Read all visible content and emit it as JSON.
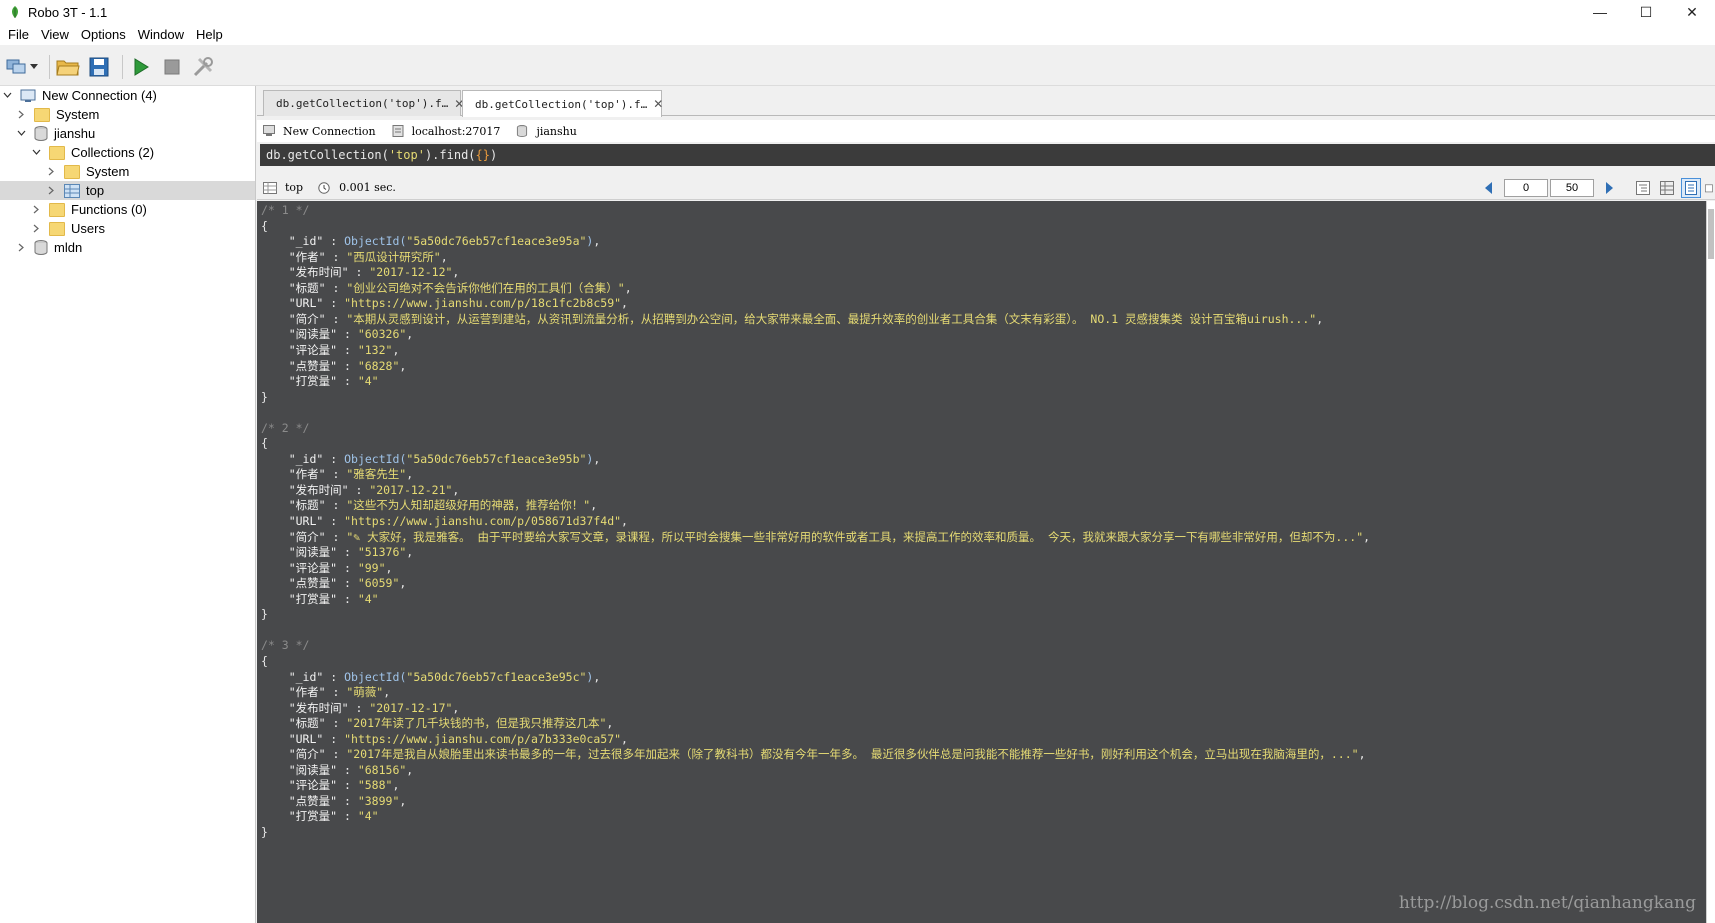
{
  "window": {
    "title": "Robo 3T - 1.1",
    "minimize_glyph": "—",
    "maximize_glyph": "☐",
    "close_glyph": "✕"
  },
  "menu": [
    "File",
    "View",
    "Options",
    "Window",
    "Help"
  ],
  "toolbar": {
    "icons": [
      "connect-icon",
      "dropdown-arrow-icon",
      "open-folder-icon",
      "save-icon",
      "run-icon",
      "stop-icon",
      "tools-icon"
    ]
  },
  "tree": {
    "connection": "New Connection (4)",
    "system_db": "System",
    "db_jianshu": "jianshu",
    "collections": "Collections (2)",
    "collections_system": "System",
    "collection_top": "top",
    "functions": "Functions (0)",
    "users": "Users",
    "db_mldn": "mldn"
  },
  "tabs": [
    {
      "label": "db.getCollection('top').f…",
      "active": false
    },
    {
      "label": "db.getCollection('top').f…",
      "active": true
    }
  ],
  "tab_close_glyph": "✕",
  "info": {
    "connection": "New Connection",
    "host": "localhost:27017",
    "database": "jianshu"
  },
  "query": {
    "prefix": "db.getCollection(",
    "collection": "'top'",
    "middle": ").find(",
    "arg": "{}",
    "suffix": ")"
  },
  "results": {
    "collection": "top",
    "time": "0.001 sec.",
    "skip": "0",
    "limit": "50"
  },
  "documents": [
    {
      "comment": "/* 1 */",
      "id": "5a50dc76eb57cf1eace3e95a",
      "fields": [
        {
          "key": "\"作者\"",
          "value": "\"西瓜设计研究所\""
        },
        {
          "key": "\"发布时间\"",
          "value": "\"2017-12-12\""
        },
        {
          "key": "\"标题\"",
          "value": "\"创业公司绝对不会告诉你他们在用的工具们（合集）\""
        },
        {
          "key": "\"URL\"",
          "value": "\"https://www.jianshu.com/p/18c1fc2b8c59\""
        },
        {
          "key": "\"简介\"",
          "value": "\"本期从灵感到设计，从运营到建站，从资讯到流量分析，从招聘到办公空间，给大家带来最全面、最提升效率的创业者工具合集（文末有彩蛋）。 NO.1 灵感搜集类 设计百宝箱uirush...\""
        },
        {
          "key": "\"阅读量\"",
          "value": "\"60326\""
        },
        {
          "key": "\"评论量\"",
          "value": "\"132\""
        },
        {
          "key": "\"点赞量\"",
          "value": "\"6828\""
        },
        {
          "key": "\"打赏量\"",
          "value": "\"4\""
        }
      ]
    },
    {
      "comment": "/* 2 */",
      "id": "5a50dc76eb57cf1eace3e95b",
      "fields": [
        {
          "key": "\"作者\"",
          "value": "\"雅客先生\""
        },
        {
          "key": "\"发布时间\"",
          "value": "\"2017-12-21\""
        },
        {
          "key": "\"标题\"",
          "value": "\"这些不为人知却超级好用的神器，推荐给你！\""
        },
        {
          "key": "\"URL\"",
          "value": "\"https://www.jianshu.com/p/058671d37f4d\""
        },
        {
          "key": "\"简介\"",
          "value": "\"✎ 大家好，我是雅客。 由于平时要给大家写文章，录课程，所以平时会搜集一些非常好用的软件或者工具，来提高工作的效率和质量。 今天，我就来跟大家分享一下有哪些非常好用，但却不为...\""
        },
        {
          "key": "\"阅读量\"",
          "value": "\"51376\""
        },
        {
          "key": "\"评论量\"",
          "value": "\"99\""
        },
        {
          "key": "\"点赞量\"",
          "value": "\"6059\""
        },
        {
          "key": "\"打赏量\"",
          "value": "\"4\""
        }
      ]
    },
    {
      "comment": "/* 3 */",
      "id": "5a50dc76eb57cf1eace3e95c",
      "fields": [
        {
          "key": "\"作者\"",
          "value": "\"萌薇\""
        },
        {
          "key": "\"发布时间\"",
          "value": "\"2017-12-17\""
        },
        {
          "key": "\"标题\"",
          "value": "\"2017年读了几千块钱的书，但是我只推荐这几本\""
        },
        {
          "key": "\"URL\"",
          "value": "\"https://www.jianshu.com/p/a7b333e0ca57\""
        },
        {
          "key": "\"简介\"",
          "value": "\"2017年是我自从娘胎里出来读书最多的一年，过去很多年加起来（除了教科书）都没有今年一年多。 最近很多伙伴总是问我能不能推荐一些好书，刚好利用这个机会，立马出现在我脑海里的，...\""
        },
        {
          "key": "\"阅读量\"",
          "value": "\"68156\""
        },
        {
          "key": "\"评论量\"",
          "value": "\"588\""
        },
        {
          "key": "\"点赞量\"",
          "value": "\"3899\""
        },
        {
          "key": "\"打赏量\"",
          "value": "\"4\""
        }
      ]
    }
  ],
  "watermark": "http://blog.csdn.net/qianhangkang",
  "colors": {
    "code_bg": "#48494b",
    "string": "#e6db74",
    "comment": "#8b8b8b",
    "function": "#9fc3e8"
  }
}
